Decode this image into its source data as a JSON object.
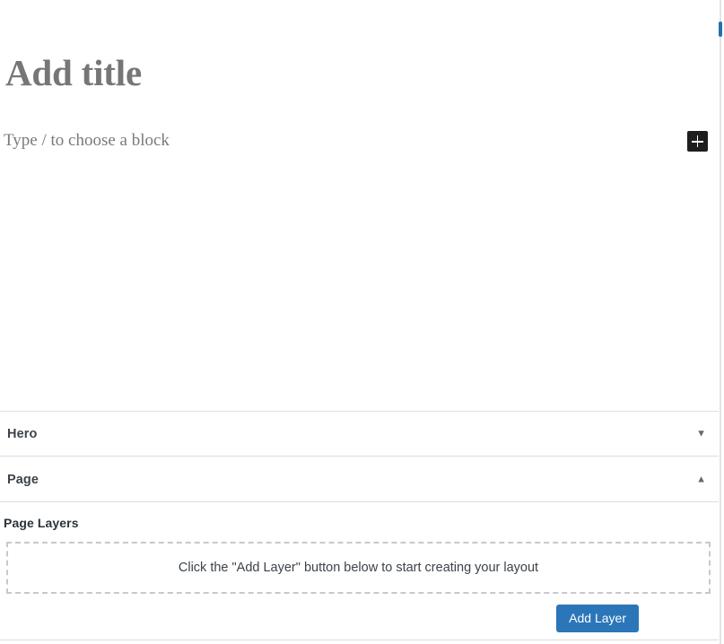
{
  "editor": {
    "title_placeholder": "Add title",
    "block_placeholder": "Type / to choose a block",
    "add_block_icon": "plus-icon"
  },
  "panels": [
    {
      "id": "hero",
      "label": "Hero",
      "expanded": false,
      "toggle_icon": "chevron-down-icon",
      "toggle_glyph": "▼"
    },
    {
      "id": "page",
      "label": "Page",
      "expanded": true,
      "toggle_icon": "chevron-up-icon",
      "toggle_glyph": "▲"
    }
  ],
  "page_panel": {
    "layers_heading": "Page Layers",
    "empty_state_text": "Click the \"Add Layer\" button below to start creating your layout",
    "add_layer_label": "Add Layer"
  },
  "colors": {
    "accent_blue": "#2b76b8",
    "add_block_dark": "#1e1e1e",
    "title_gray": "#767676",
    "border_gray": "#dcdcde",
    "dashed_border": "#c8c8cc",
    "scrollbar_thumb": "#2271b1"
  },
  "scrollbar": {
    "name": "vertical-scrollbar"
  }
}
